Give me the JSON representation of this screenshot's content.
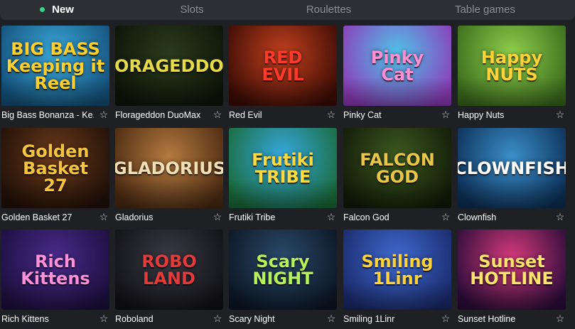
{
  "tabs": [
    {
      "label": "New",
      "active": true
    },
    {
      "label": "Slots",
      "active": false
    },
    {
      "label": "Roulettes",
      "active": false
    },
    {
      "label": "Table games",
      "active": false
    }
  ],
  "favorite_icon": "☆",
  "games": [
    {
      "title": "Big Bass Bonanza - Ke...",
      "logo": "BIG BASS\nKeeping it Reel",
      "bg1": "#3aa7d8",
      "bg2": "#14507a",
      "logo_color": "#ffcf2e"
    },
    {
      "title": "Florageddon DuoMax",
      "logo": "FLORAGEDDON!",
      "bg1": "#2a3a1c",
      "bg2": "#0e1408",
      "logo_color": "#e6d94a"
    },
    {
      "title": "Red Evil",
      "logo": "RED\nEVIL",
      "bg1": "#c2401e",
      "bg2": "#3b0c05",
      "logo_color": "#ff3a2a"
    },
    {
      "title": "Pinky Cat",
      "logo": "Pinky\nCat",
      "bg1": "#4fc4ea",
      "bg2": "#8d3bb8",
      "logo_color": "#ff8fd1"
    },
    {
      "title": "Happy Nuts",
      "logo": "Happy\nNUTS",
      "bg1": "#8fcf4c",
      "bg2": "#3a6a1c",
      "logo_color": "#ffd23a"
    },
    {
      "title": "Golden Basket 27",
      "logo": "Golden\nBasket\n27",
      "bg1": "#6b3a1a",
      "bg2": "#201008",
      "logo_color": "#f5c542"
    },
    {
      "title": "Gladorius",
      "logo": "GLADORIUS",
      "bg1": "#b47a3f",
      "bg2": "#4a2a12",
      "logo_color": "#f1dfb6"
    },
    {
      "title": "Frutiki Tribe",
      "logo": "Frutiki\nTRIBE",
      "bg1": "#36a9e0",
      "bg2": "#1a6a3a",
      "logo_color": "#ffd93d"
    },
    {
      "title": "Falcon God",
      "logo": "FALCON\nGOD",
      "bg1": "#3d5a20",
      "bg2": "#121a08",
      "logo_color": "#e9c64a"
    },
    {
      "title": "Clownfish",
      "logo": "CLOWNFISH",
      "bg1": "#3b8ec9",
      "bg2": "#0c2f55",
      "logo_color": "#ffffff"
    },
    {
      "title": "Rich Kittens",
      "logo": "Rich\nKittens",
      "bg1": "#4a2a8a",
      "bg2": "#1c0f3e",
      "logo_color": "#ff8fd8"
    },
    {
      "title": "Roboland",
      "logo": "ROBO\nLAND",
      "bg1": "#3a3a45",
      "bg2": "#111116",
      "logo_color": "#e43a3a"
    },
    {
      "title": "Scary Night",
      "logo": "Scary\nNIGHT",
      "bg1": "#2a4a6a",
      "bg2": "#0c1624",
      "logo_color": "#b8f25a"
    },
    {
      "title": "Smiling 1Linr",
      "logo": "Smiling\n1Linr",
      "bg1": "#3f6ad0",
      "bg2": "#1a2a6a",
      "logo_color": "#ffd23a"
    },
    {
      "title": "Sunset Hotline",
      "logo": "Sunset\nHOTLINE",
      "bg1": "#d43a7a",
      "bg2": "#2a0c3a",
      "logo_color": "#ffe36a"
    }
  ]
}
